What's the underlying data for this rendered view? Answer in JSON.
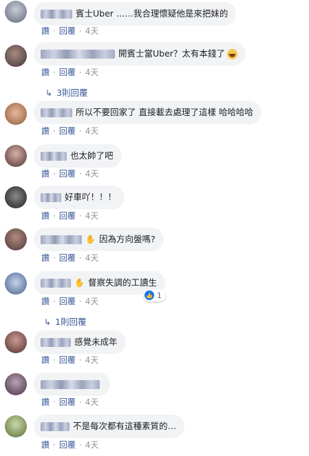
{
  "comments": [
    {
      "text": "賓士Uber ……我合理懷疑他是來把妹的",
      "like": "讚",
      "reply": "回覆",
      "time": "4天"
    },
    {
      "text": "開賓士當Uber？太有本錢了",
      "like": "讚",
      "reply": "回覆",
      "time": "4天",
      "replies": "3則回覆"
    },
    {
      "text": "所以不要回家了 直接載去處理了這樣 哈哈哈哈",
      "like": "讚",
      "reply": "回覆",
      "time": "4天"
    },
    {
      "text": "也太帥了吧",
      "like": "讚",
      "reply": "回覆",
      "time": "4天"
    },
    {
      "text": "好車吖！！！",
      "like": "讚",
      "reply": "回覆",
      "time": "4天"
    },
    {
      "text": "因為方向盤嗎?",
      "like": "讚",
      "reply": "回覆",
      "time": "4天"
    },
    {
      "text": "督察失調的工讀生",
      "like": "讚",
      "reply": "回覆",
      "time": "4天",
      "reaction_count": "1",
      "replies": "1則回覆"
    },
    {
      "text": "感覺未成年",
      "like": "讚",
      "reply": "回覆",
      "time": "4天"
    },
    {
      "text": "",
      "like": "讚",
      "reply": "回覆",
      "time": "4天"
    },
    {
      "text": "不是每次都有這種素質的…",
      "like": "讚",
      "reply": "回覆",
      "time": "4天"
    }
  ],
  "colors": {
    "link": "#385898",
    "bubble": "#f2f3f5",
    "meta": "#90949c",
    "like_badge": "#1877f2"
  },
  "icons": {
    "reply_arrow": "reply-arrow-icon",
    "wave": "wave-hand-icon",
    "laugh": "laughing-emoji-icon",
    "like": "like-thumb-icon"
  }
}
